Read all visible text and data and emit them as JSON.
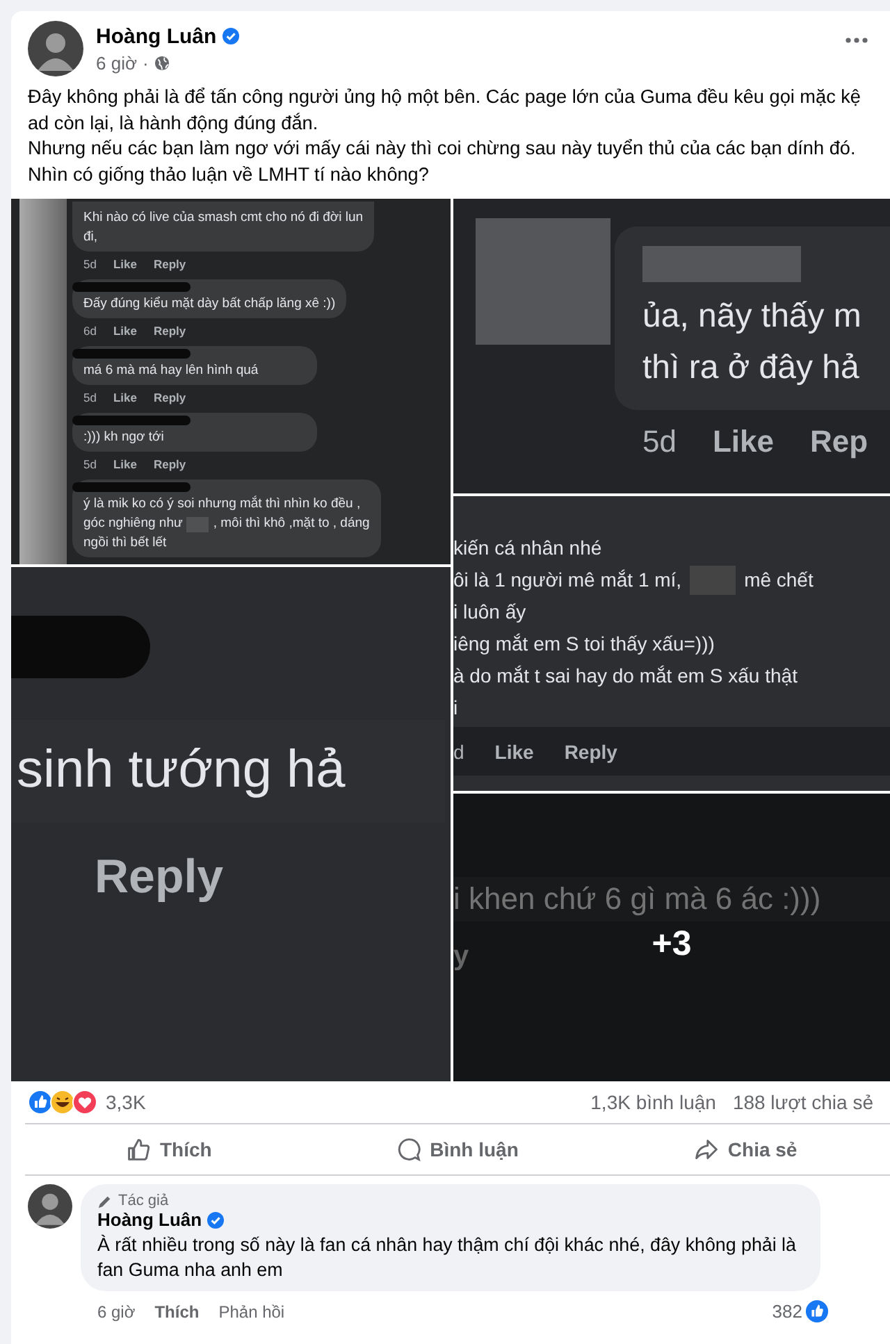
{
  "post": {
    "author": "Hoàng Luân",
    "time": "6 giờ",
    "separator": "·",
    "paragraphs": [
      "Đây không phải là để tấn công người ủng hộ một bên. Các page lớn của Guma đều kêu gọi mặc kệ ad còn lại, là hành động đúng đắn.",
      "Nhưng nếu các bạn làm ngơ với mấy cái này thì coi chừng sau này tuyển thủ của các bạn dính đó.",
      "Nhìn có giống thảo luận về LMHT tí nào không?"
    ]
  },
  "photos": [
    {
      "kind": "small",
      "comments": [
        {
          "lines": [
            [
              "Khi nào có live của smash cmt cho nó đi đời lun"
            ],
            [
              "đi,"
            ]
          ],
          "meta": [
            {
              "kind": "time",
              "text": "5d"
            },
            {
              "kind": "like",
              "text": "Like"
            },
            {
              "kind": "reply",
              "text": "Reply"
            }
          ]
        },
        {
          "lines": [
            [
              "Đấy đúng kiểu mặt dày bất chấp lăng xê :))"
            ]
          ],
          "meta": [
            {
              "kind": "time",
              "text": "6d"
            },
            {
              "kind": "like",
              "text": "Like"
            },
            {
              "kind": "reply",
              "text": "Reply"
            }
          ]
        },
        {
          "lines": [
            [
              "má 6 mà má hay lên hình quá"
            ]
          ],
          "meta": [
            {
              "kind": "time",
              "text": "5d"
            },
            {
              "kind": "like",
              "text": "Like"
            },
            {
              "kind": "reply",
              "text": "Reply"
            }
          ]
        },
        {
          "lines": [
            [
              ":))) kh ngơ tới"
            ]
          ],
          "meta": [
            {
              "kind": "time",
              "text": "5d"
            },
            {
              "kind": "like",
              "text": "Like"
            },
            {
              "kind": "reply",
              "text": "Reply"
            }
          ]
        },
        {
          "lines": [
            [
              "ý là mik ko có ý soi nhưng mắt thì nhìn ko đều ,"
            ],
            [
              "góc nghiêng như",
              ", môi thì khô ,mặt to , dáng"
            ],
            [
              "ngồi thì bết lết"
            ]
          ]
        }
      ]
    },
    {
      "kind": "large",
      "comments": [
        {
          "lines": [
            [
              "ủa, nãy thấy m"
            ],
            [
              "thì ra ở đây hả"
            ]
          ],
          "meta": [
            {
              "kind": "time",
              "text": "5d"
            },
            {
              "kind": "like",
              "text": "Like"
            },
            {
              "kind": "reply",
              "text": "Rep"
            }
          ]
        }
      ]
    },
    {
      "kind": "medium",
      "comments": [
        {
          "lines": [
            [
              "kiến cá nhân nhé"
            ],
            [
              "ôi là 1 người mê mắt 1 mí,",
              "mê chết"
            ],
            [
              "i luôn ấy"
            ],
            [
              "iêng mắt em S toi thấy xấu=)))"
            ],
            [
              "à do mắt t sai hay do mắt em S xấu thật"
            ],
            [
              "i"
            ]
          ],
          "meta": [
            {
              "kind": "time",
              "text": "d"
            },
            {
              "kind": "like",
              "text": "Like"
            },
            {
              "kind": "reply",
              "text": "Reply"
            }
          ]
        }
      ]
    },
    {
      "kind": "huge",
      "comments": [
        {
          "lines": [
            [
              "sinh tướng hả"
            ]
          ],
          "meta": [
            {
              "kind": "reply",
              "text": "Reply"
            }
          ]
        }
      ]
    },
    {
      "kind": "wide",
      "more": "+3",
      "comments": [
        {
          "lines": [
            [
              "i khen chứ 6 gì mà 6 ác :)))"
            ]
          ],
          "meta": [
            {
              "kind": "reply",
              "text": "y"
            }
          ]
        }
      ]
    }
  ],
  "stats": {
    "reactions": "3,3K",
    "comments": "1,3K bình luận",
    "shares": "188 lượt chia sẻ"
  },
  "actions": [
    {
      "kind": "like",
      "label": "Thích"
    },
    {
      "kind": "comment",
      "label": "Bình luận"
    },
    {
      "kind": "share",
      "label": "Chia sẻ"
    }
  ],
  "comment": {
    "badge": "Tác giả",
    "author": "Hoàng Luân",
    "text": "À rất nhiều trong số này là fan cá nhân hay thậm chí đội khác nhé, đây không phải là fan Guma nha anh em",
    "time": "6 giờ",
    "like": "Thích",
    "reply": "Phản hồi",
    "likes": "382"
  }
}
